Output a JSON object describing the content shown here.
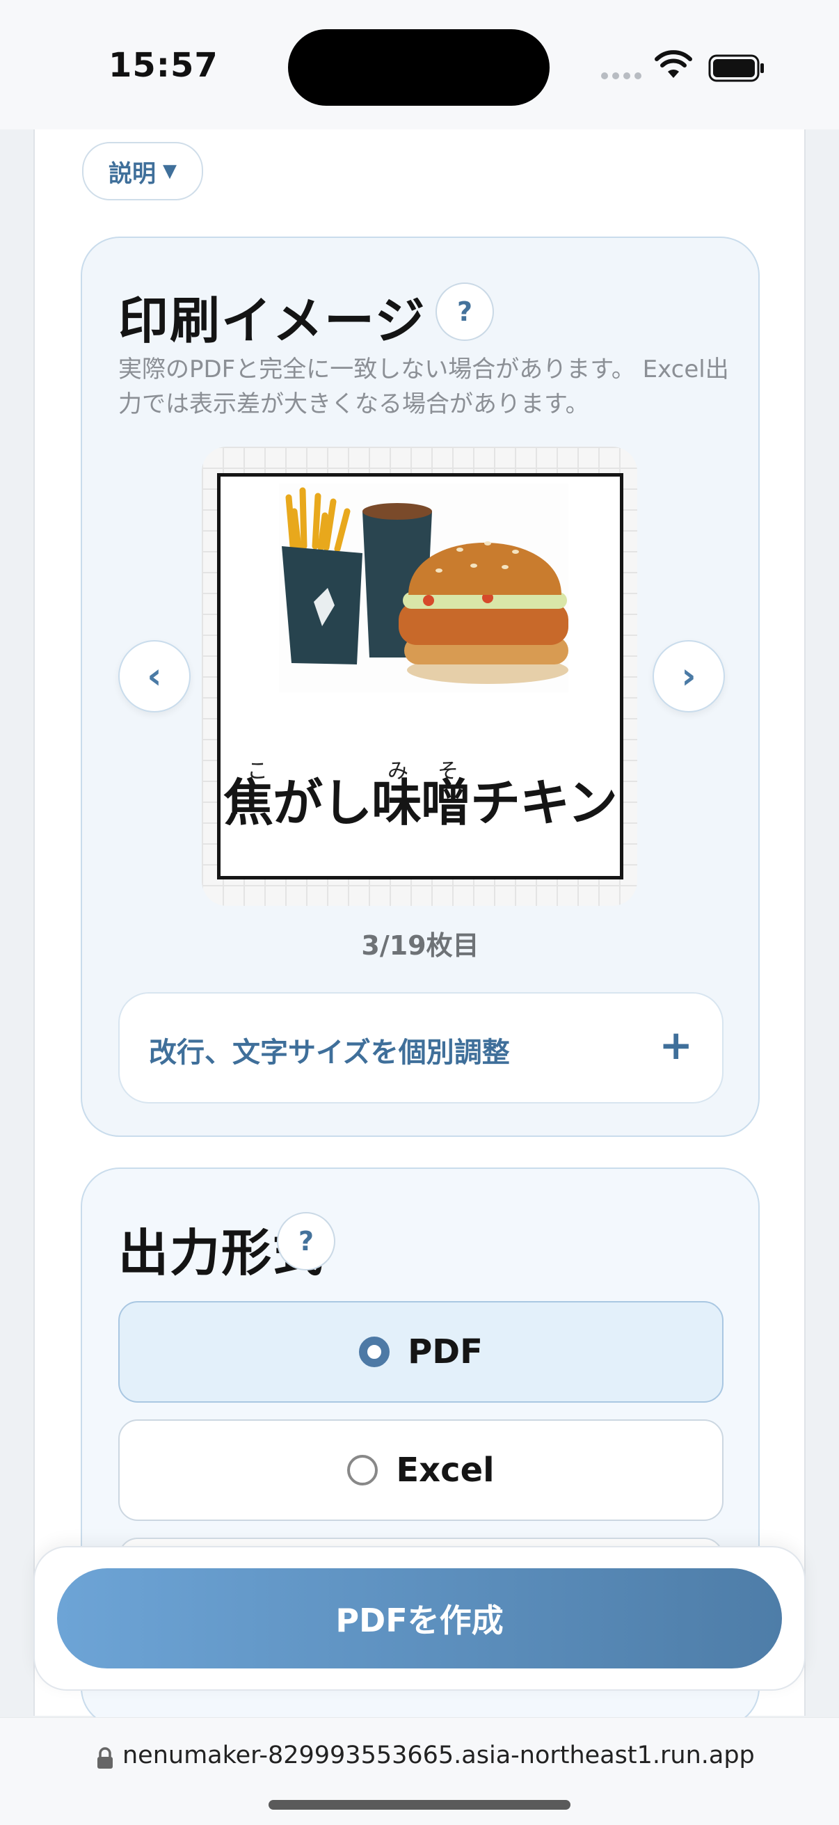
{
  "status_bar": {
    "time": "15:57"
  },
  "explain": {
    "label": "説明",
    "arrow": "▼"
  },
  "preview": {
    "title": "印刷イメージ",
    "help": "?",
    "note": "実際のPDFと完全に一致しない場合があります。 Excel出力では表示差が大きくなる場合があります。",
    "menu_name": "焦がし味噌チキン",
    "furigana": [
      "こ",
      "み",
      "そ"
    ],
    "prev": "‹",
    "next": "›",
    "counter": "3/19枚目",
    "adjust_label": "改行、文字サイズを個別調整",
    "adjust_icon": "+"
  },
  "output_format": {
    "title": "出力形式",
    "help": "?",
    "options": [
      {
        "label": "PDF",
        "selected": true
      },
      {
        "label": "Excel",
        "selected": false
      }
    ]
  },
  "action": {
    "create_label": "PDFを作成"
  },
  "browser": {
    "url": "nenumaker-829993553665.asia-northeast1.run.app"
  },
  "colors": {
    "accent": "#4d79a5",
    "button_gradient_start": "#6da4d6",
    "button_gradient_end": "#4e7da8"
  }
}
